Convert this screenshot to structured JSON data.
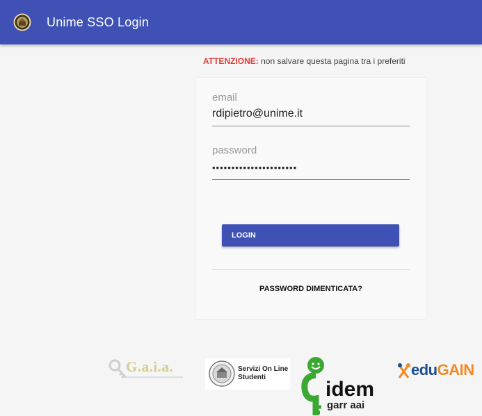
{
  "app": {
    "title": "Unime SSO Login",
    "logo_icon": "university-seal-icon",
    "accent_color": "#3f51b5"
  },
  "notice": {
    "label": "ATTENZIONE:",
    "text": " non salvare questa pagina tra i preferiti",
    "label_color": "#e53935"
  },
  "form": {
    "email": {
      "label": "email",
      "value": "rdipietro@unime.it"
    },
    "password": {
      "label": "password",
      "value": "••••••••••••••••••••••"
    },
    "login_label": "LOGIN",
    "forgot_label": "PASSWORD DIMENTICATA?"
  },
  "footer": {
    "gaia": {
      "text": "G.a.i.a."
    },
    "sol": {
      "line1": "Servizi On Line",
      "line2": "Studenti"
    },
    "idem": {
      "text1": "idem",
      "text2": "garr aai"
    },
    "edugain": {
      "part1": "edu",
      "part2": "GAIN"
    }
  }
}
